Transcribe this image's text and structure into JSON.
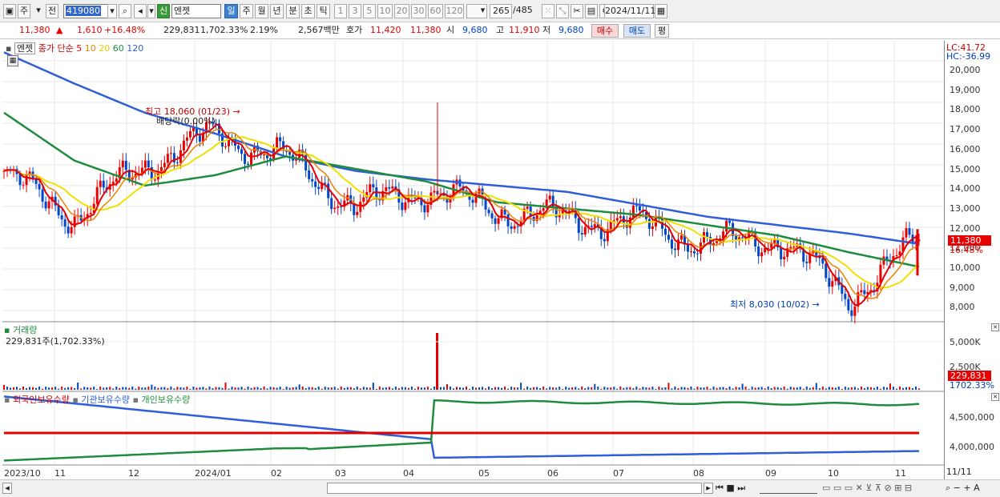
{
  "toolbar": {
    "market": "주",
    "market_all": "전",
    "code": "419080",
    "badge": "신",
    "name": "엔젯",
    "periods": [
      "일",
      "주",
      "월",
      "년",
      "분",
      "초",
      "틱"
    ],
    "period_nums": [
      "1",
      "3",
      "5",
      "10",
      "20",
      "30",
      "60",
      "120"
    ],
    "count": "265",
    "count_total": "/485",
    "date": "2024/11/11"
  },
  "quote": {
    "price": "11,380",
    "arrow": "▲",
    "change": "1,610",
    "change_pct": "+16.48%",
    "volume": "229,831",
    "volume_pct": "1,702.33%",
    "turnover_pct": "2.19%",
    "amount": "2,567백만",
    "ask_label": "호가",
    "ask": "11,420",
    "bid": "11,380",
    "open_label": "시",
    "open": "9,680",
    "high_label": "고",
    "high": "11,910",
    "low_label": "저",
    "low": "9,680",
    "buy_label": "매수",
    "sell_label": "매도",
    "eval_label": "평"
  },
  "legend": {
    "name": "엔젯",
    "price_label": "종가 단순",
    "ma5": "5",
    "ma10": "10",
    "ma20": "20",
    "ma60": "60",
    "ma120": "120"
  },
  "annotations": {
    "high": "최고 18,060 (01/23)",
    "dividend": "배당락(0.00%)",
    "low": "최저 8,030 (10/02)"
  },
  "price_axis": {
    "lc": "LC:41.72",
    "hc": "HC:-36.99",
    "ticks": [
      "20,000",
      "19,000",
      "18,000",
      "17,000",
      "16,000",
      "15,000",
      "14,000",
      "13,000",
      "12,000",
      "11,000",
      "10,000",
      "9,000",
      "8,000"
    ],
    "current": "11,380",
    "current_pct": "16.48%"
  },
  "volume_panel": {
    "title": "거래량",
    "value": "229,831주(1,702.33%)",
    "ticks": [
      "5,000K",
      "2,500K"
    ],
    "current": "229,831",
    "current_pct": "1702.33%"
  },
  "holding_panel": {
    "foreign": "외국인보유수량",
    "inst": "기관보유수량",
    "indiv": "개인보유수량",
    "ticks": [
      "4,500,000",
      "4,000,000"
    ]
  },
  "x_axis": {
    "labels": [
      "2023/10",
      "11",
      "12",
      "2024/01",
      "02",
      "03",
      "04",
      "05",
      "06",
      "07",
      "08",
      "09",
      "10",
      "11",
      "11/11"
    ]
  },
  "colors": {
    "up": "#e60000",
    "down": "#0046c8",
    "ma5": "#e60000",
    "ma10": "#f08000",
    "ma20": "#f0e000",
    "ma60": "#1e8c3c",
    "ma120": "#2e5fd8"
  },
  "chart_data": {
    "type": "line",
    "title": "엔젯",
    "series": [
      {
        "name": "120",
        "x": [
          "2023/10",
          "2023/11",
          "2023/12",
          "2024/01",
          "2024/02",
          "2024/03",
          "2024/04",
          "2024/05",
          "2024/06",
          "2024/07",
          "2024/08",
          "2024/09",
          "2024/10",
          "2024/11/11"
        ],
        "values": [
          20400,
          18900,
          17500,
          16500,
          15400,
          14700,
          14300,
          14000,
          13700,
          13100,
          12500,
          12100,
          11700,
          11200
        ]
      },
      {
        "name": "60",
        "x": [
          "2023/10",
          "2023/11",
          "2023/12",
          "2024/01",
          "2024/02",
          "2024/03",
          "2024/04",
          "2024/05",
          "2024/06",
          "2024/07",
          "2024/08",
          "2024/09",
          "2024/10",
          "2024/11/11"
        ],
        "values": [
          17500,
          15200,
          14000,
          14500,
          15400,
          14800,
          14200,
          13200,
          12900,
          12600,
          12100,
          11600,
          10800,
          10100
        ]
      },
      {
        "name": "close",
        "x": [
          "2023/10",
          "2023/11",
          "2023/12",
          "2024/01",
          "2024/02",
          "2024/03",
          "2024/04",
          "2024/05",
          "2024/06",
          "2024/07",
          "2024/08",
          "2024/09",
          "2024/10",
          "2024/11/11"
        ],
        "values": [
          14500,
          12500,
          15000,
          16500,
          15300,
          13000,
          13800,
          12800,
          12400,
          12200,
          11200,
          11500,
          8600,
          11380
        ]
      }
    ],
    "ylim": [
      7500,
      20800
    ]
  }
}
